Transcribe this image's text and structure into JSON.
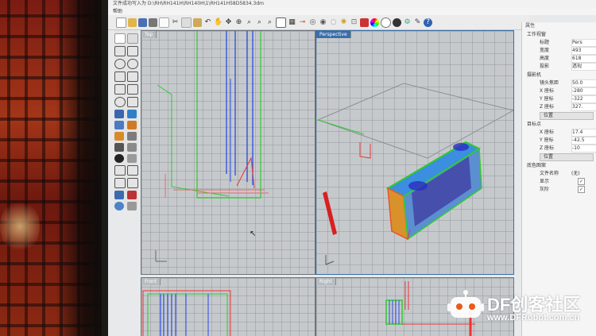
{
  "window": {
    "status_line": "文件成功写入为 D:\\RH\\RH141H\\RH140H\\1\\RH141H58D5834.3dm",
    "menu": "帮助"
  },
  "viewports": {
    "top": "Top",
    "perspective": "Perspective",
    "front": "Front",
    "right": "Right"
  },
  "properties_panel": {
    "header": "属性",
    "section_viewport": "工作视窗",
    "rows_viewport": [
      {
        "label": "标题",
        "value": "Pers"
      },
      {
        "label": "宽度",
        "value": "493"
      },
      {
        "label": "高度",
        "value": "618"
      },
      {
        "label": "投影",
        "value": "透视"
      }
    ],
    "section_camera": "摄影机",
    "rows_camera": [
      {
        "label": "镜头焦距",
        "value": "50.0"
      },
      {
        "label": "X 座标",
        "value": "-280"
      },
      {
        "label": "Y 座标",
        "value": "-322"
      },
      {
        "label": "Z 座标",
        "value": "327."
      }
    ],
    "camera_position_button": "位置",
    "section_target": "目标点",
    "rows_target": [
      {
        "label": "X 座标",
        "value": "17.4"
      },
      {
        "label": "Y 座标",
        "value": "-42.5"
      },
      {
        "label": "Z 座标",
        "value": "-10"
      }
    ],
    "target_position_button": "位置",
    "section_background": "底色图案",
    "rows_background": [
      {
        "label": "文件名称",
        "value": "(无)"
      },
      {
        "label": "显示",
        "value": "✓"
      },
      {
        "label": "灰阶",
        "value": "✓"
      }
    ]
  },
  "watermark": {
    "brand": "DF创客社区",
    "url": "www.DFRobot.com.cn"
  }
}
